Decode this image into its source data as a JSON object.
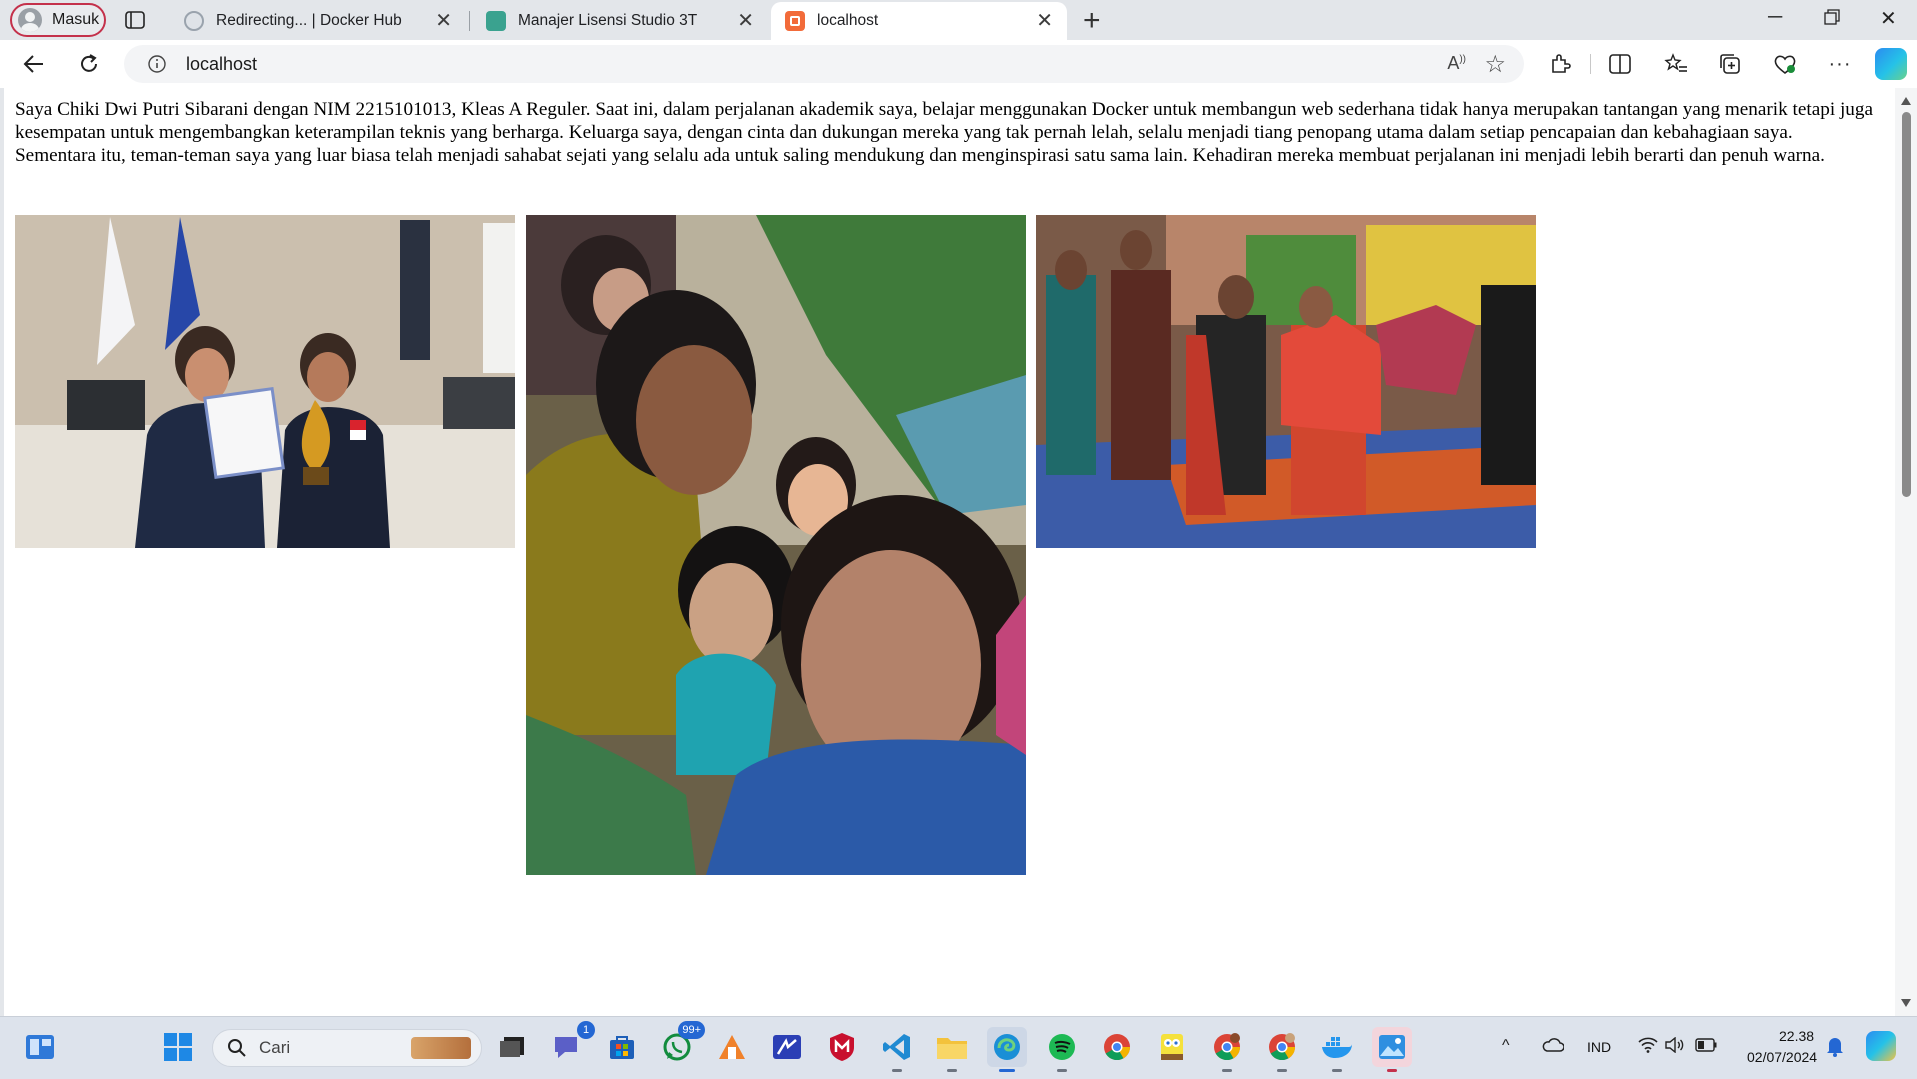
{
  "browser": {
    "profile_label": "Masuk",
    "tabs": [
      {
        "title": "Redirecting... | Docker Hub",
        "active": false
      },
      {
        "title": "Manajer Lisensi Studio 3T",
        "active": false
      },
      {
        "title": "localhost",
        "active": true
      }
    ],
    "address": "localhost"
  },
  "page": {
    "paragraph": "Saya Chiki Dwi Putri Sibarani dengan NIM 2215101013, Kleas A Reguler. Saat ini, dalam perjalanan akademik saya, belajar menggunakan Docker untuk membangun web sederhana tidak hanya merupakan tantangan yang menarik tetapi juga kesempatan untuk mengembangkan keterampilan teknis yang berharga. Keluarga saya, dengan cinta dan dukungan mereka yang tak pernah lelah, selalu menjadi tiang penopang utama dalam setiap pencapaian dan kebahagiaan saya. Sementara itu, teman-teman saya yang luar biasa telah menjadi sahabat sejati yang selalu ada untuk saling mendukung dan menginspirasi satu sama lain. Kehadiran mereka membuat perjalanan ini menjadi lebih berarti dan penuh warna."
  },
  "taskbar": {
    "search_placeholder": "Cari",
    "teams_badge": "1",
    "whatsapp_badge": "99+",
    "language": "IND",
    "time": "22.38",
    "date": "02/07/2024"
  }
}
